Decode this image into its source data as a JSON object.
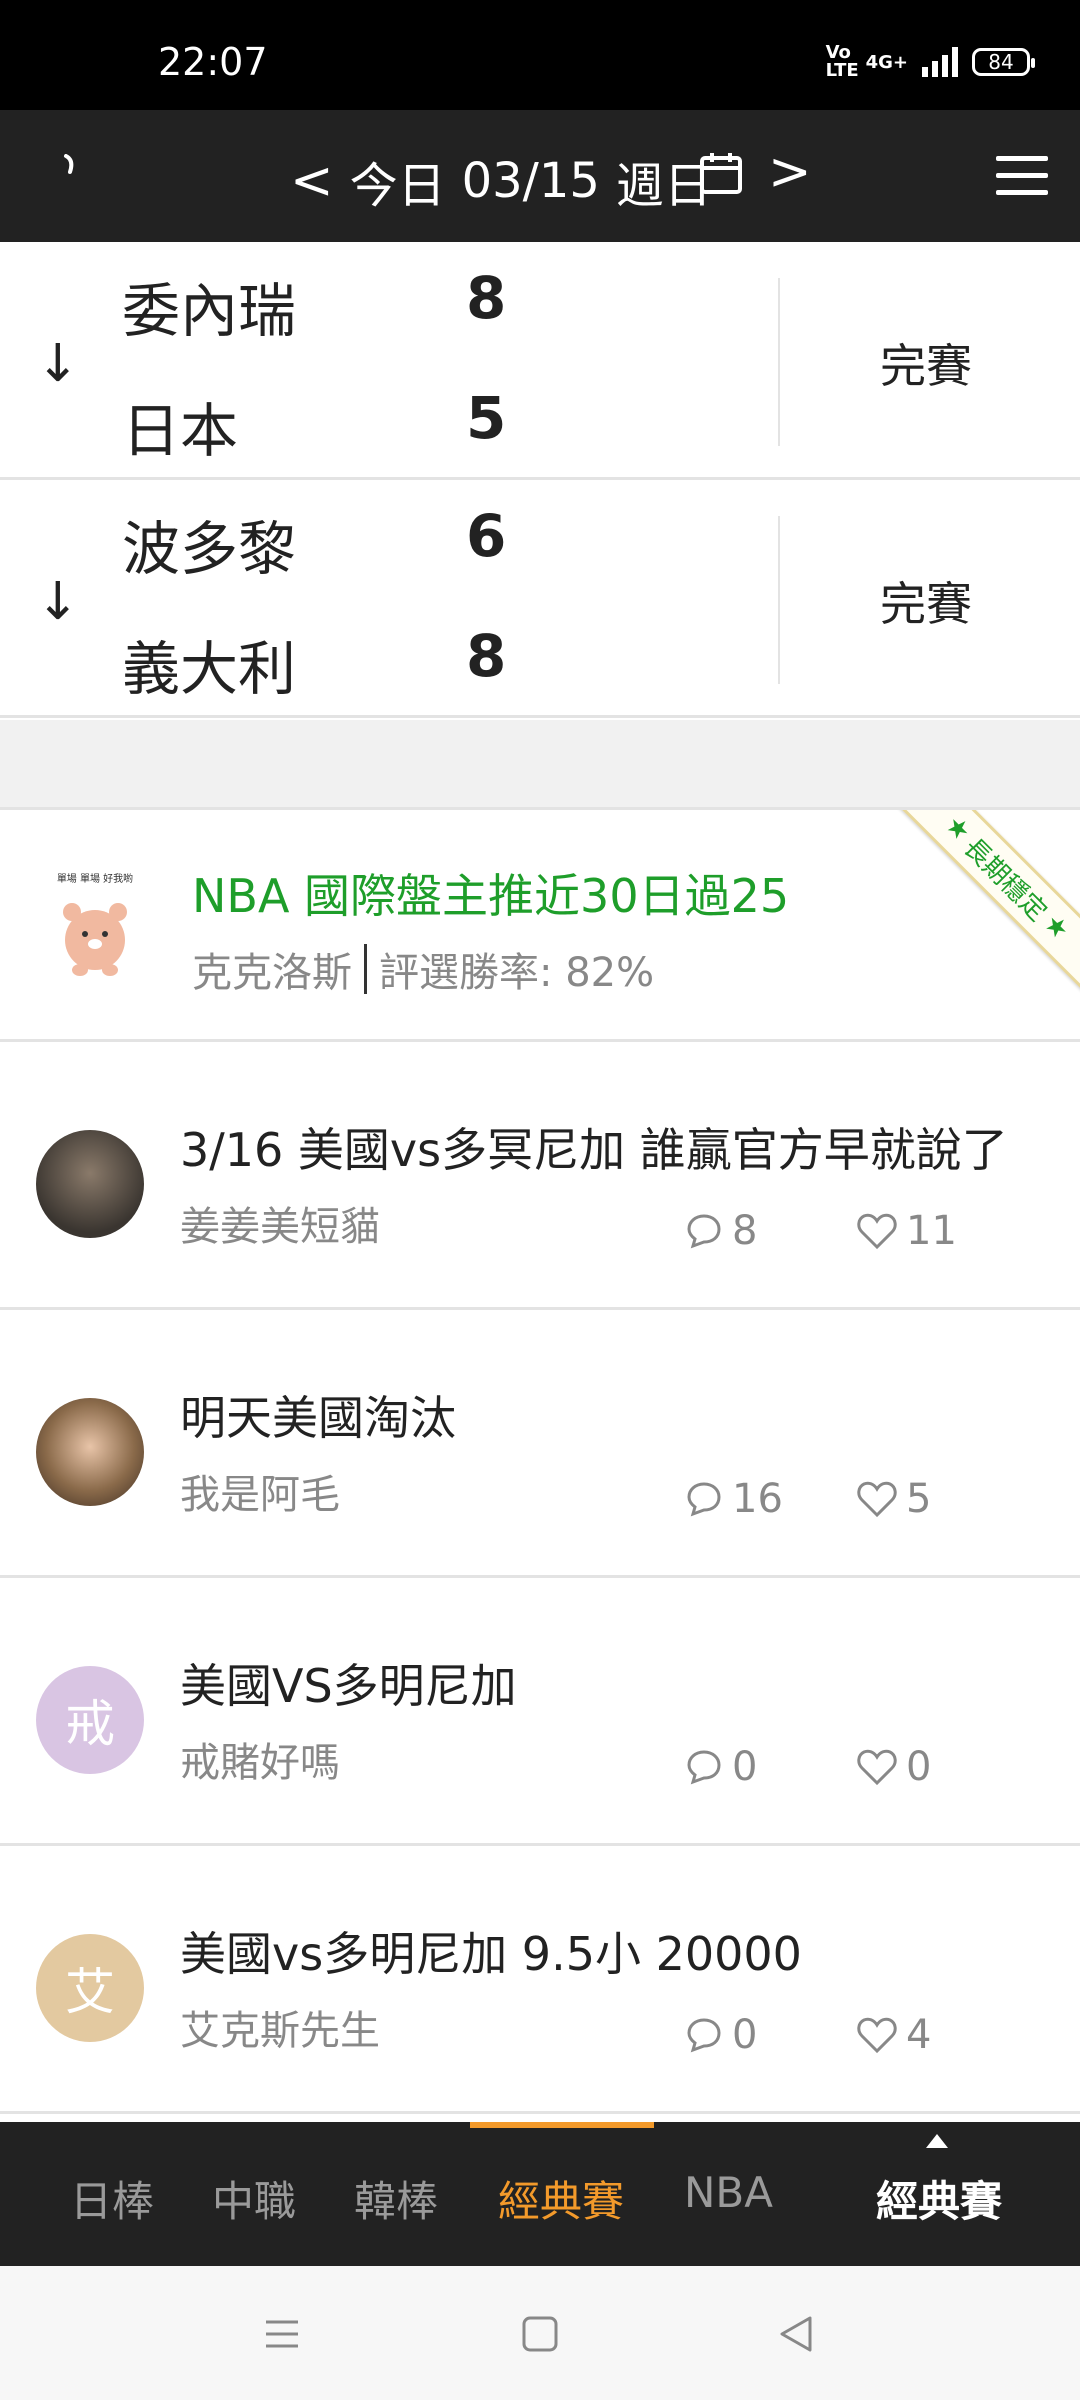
{
  "status_bar": {
    "time": "22:07",
    "volte": "Vo LTE",
    "network": "4G+",
    "battery": "84"
  },
  "header": {
    "prev": "<",
    "today": "今日",
    "date": "03/15",
    "weekday": "週日",
    "next": ">"
  },
  "games": [
    {
      "teams": [
        {
          "name": "委內瑞",
          "score": "8"
        },
        {
          "name": "日本",
          "score": "5"
        }
      ],
      "status": "完賽"
    },
    {
      "teams": [
        {
          "name": "波多黎",
          "score": "6"
        },
        {
          "name": "義大利",
          "score": "8"
        }
      ],
      "status": "完賽"
    }
  ],
  "promo": {
    "title": "NBA 國際盤主推近30日過25",
    "author": "克克洛斯",
    "rate_label": "評選勝率: 82%",
    "ribbon": "長期穩定",
    "avatar_caption": "單場 單場 好我喲"
  },
  "posts": [
    {
      "title": "3/16 美國vs多冥尼加 誰贏官方早就說了",
      "author": "姜姜美短貓",
      "comments": "8",
      "likes": "11",
      "avatar_text": ""
    },
    {
      "title": "明天美國淘汰",
      "author": "我是阿毛",
      "comments": "16",
      "likes": "5",
      "avatar_text": ""
    },
    {
      "title": "美國VS多明尼加",
      "author": "戒賭好嗎",
      "comments": "0",
      "likes": "0",
      "avatar_text": "戒"
    },
    {
      "title": "美國vs多明尼加 9.5小 20000",
      "author": "艾克斯先生",
      "comments": "0",
      "likes": "4",
      "avatar_text": "艾"
    }
  ],
  "tabs": [
    {
      "label": "日棒"
    },
    {
      "label": "中職"
    },
    {
      "label": "韓棒"
    },
    {
      "label": "經典賽"
    },
    {
      "label": "NBA"
    }
  ],
  "current_section": "經典賽",
  "colors": {
    "accent": "#f39a2b",
    "promo_green": "#1e9e2a",
    "header_bg": "#222222"
  }
}
